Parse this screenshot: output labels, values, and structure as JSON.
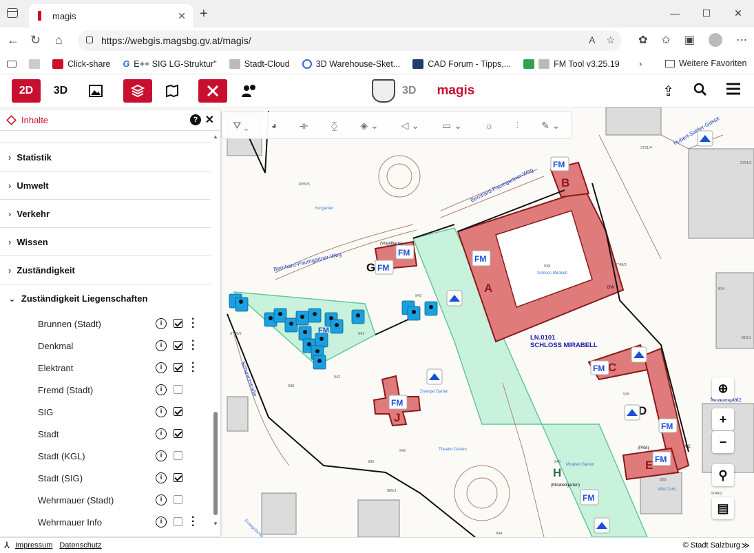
{
  "browser": {
    "tab_title": "magis",
    "url": "https://webgis.magsbg.gv.at/magis/",
    "bookmarks": [
      "Click-share",
      "E++ SIG LG-Struktur\"",
      "Stadt-Cloud",
      "3D Warehouse-Sket...",
      "CAD Forum - Tipps,...",
      "FM Tool v3.25.19"
    ],
    "more_favorites": "Weitere Favoriten"
  },
  "app": {
    "btn_2d": "2D",
    "btn_3d": "3D",
    "brand_3d": "3D",
    "brand_name": "magis"
  },
  "panel": {
    "title": "Inhalte",
    "help": "?",
    "close": "✕",
    "groups": [
      "Statistik",
      "Umwelt",
      "Verkehr",
      "Wissen",
      "Zuständigkeit",
      "Zuständigkeit Liegenschaften"
    ],
    "items": [
      {
        "label": "Brunnen (Stadt)",
        "checked": true,
        "menu": true
      },
      {
        "label": "Denkmal",
        "checked": true,
        "menu": true
      },
      {
        "label": "Elektrant",
        "checked": true,
        "menu": true
      },
      {
        "label": "Fremd (Stadt)",
        "checked": false,
        "menu": false
      },
      {
        "label": "SIG",
        "checked": true,
        "menu": false
      },
      {
        "label": "Stadt",
        "checked": true,
        "menu": false
      },
      {
        "label": "Stadt (KGL)",
        "checked": false,
        "menu": false
      },
      {
        "label": "Stadt (SIG)",
        "checked": true,
        "menu": false
      },
      {
        "label": "Wehrmauer (Stadt)",
        "checked": false,
        "menu": false
      },
      {
        "label": "Wehrmauer Info",
        "checked": false,
        "menu": true
      }
    ]
  },
  "map": {
    "streets": [
      "Bernhard-Paumgartner-Weg",
      "Bernhard-Paumgartner-Weg",
      "Hubert-Sattler-Gasse",
      "Schwarzstraße",
      "Mirabellplatz"
    ],
    "labels": {
      "kurgarten": "Kurgarten",
      "zwergel": "Zwergel Garten",
      "theater": "Theater Garten",
      "mirabell_garten": "Mirabell Garten",
      "mirabellgarten": "(Mirabellgarten)",
      "schloss": "Schloss Mirabell",
      "ln": "LN.0101",
      "schloss_big": "SCHLOSS MIRABELL",
      "vogelhaus": "(Vogelhaus)",
      "pam": "(PAM)",
      "wc": "WC",
      "dw": "DW",
      "kirche": "Evangelische Kirche",
      "villa": "Villa Cont..."
    },
    "parcels": [
      "1055/5",
      "938",
      "941",
      "942",
      "942",
      "943",
      "945",
      "908",
      "985/1",
      "3749/3",
      "3751/4",
      "3751/1",
      "935",
      "933",
      "3749/2",
      "814",
      "815/1",
      "3756/2",
      "944",
      "906"
    ],
    "building_letters": [
      "A",
      "B",
      "C",
      "D",
      "E",
      "G",
      "H",
      "J"
    ],
    "fm_badge": "FM",
    "fm_small": "FM"
  },
  "footer": {
    "impressum": "Impressum",
    "datenschutz": "Datenschutz",
    "copyright": "© Stadt Salzburg",
    "expand": "≫"
  },
  "colors": {
    "accent": "#c8102e",
    "building_fill": "#e07b7b",
    "garden_fill": "#c9f2dc",
    "garden_stroke": "#5fc79a",
    "icon_blue": "#1aa0e0"
  }
}
